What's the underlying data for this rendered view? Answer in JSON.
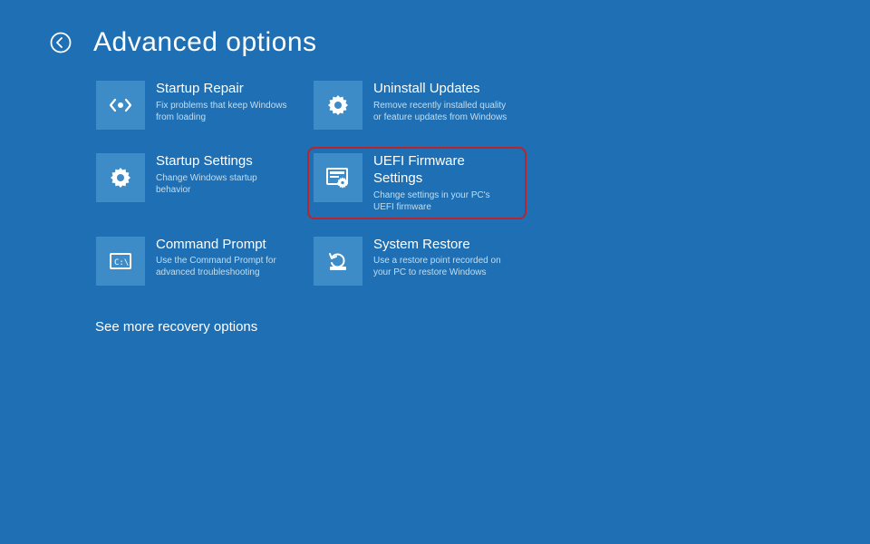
{
  "header": {
    "title": "Advanced options"
  },
  "tiles": [
    {
      "id": "startup-repair",
      "title": "Startup Repair",
      "desc": "Fix problems that keep Windows from loading"
    },
    {
      "id": "uninstall-updates",
      "title": "Uninstall Updates",
      "desc": "Remove recently installed quality or feature updates from Windows"
    },
    {
      "id": "startup-settings",
      "title": "Startup Settings",
      "desc": "Change Windows startup behavior"
    },
    {
      "id": "uefi-firmware",
      "title": "UEFI Firmware Settings",
      "desc": "Change settings in your PC's UEFI firmware",
      "highlighted": true
    },
    {
      "id": "command-prompt",
      "title": "Command Prompt",
      "desc": "Use the Command Prompt for advanced troubleshooting"
    },
    {
      "id": "system-restore",
      "title": "System Restore",
      "desc": "Use a restore point recorded on your PC to restore Windows"
    }
  ],
  "footer": {
    "see_more": "See more recovery options"
  }
}
